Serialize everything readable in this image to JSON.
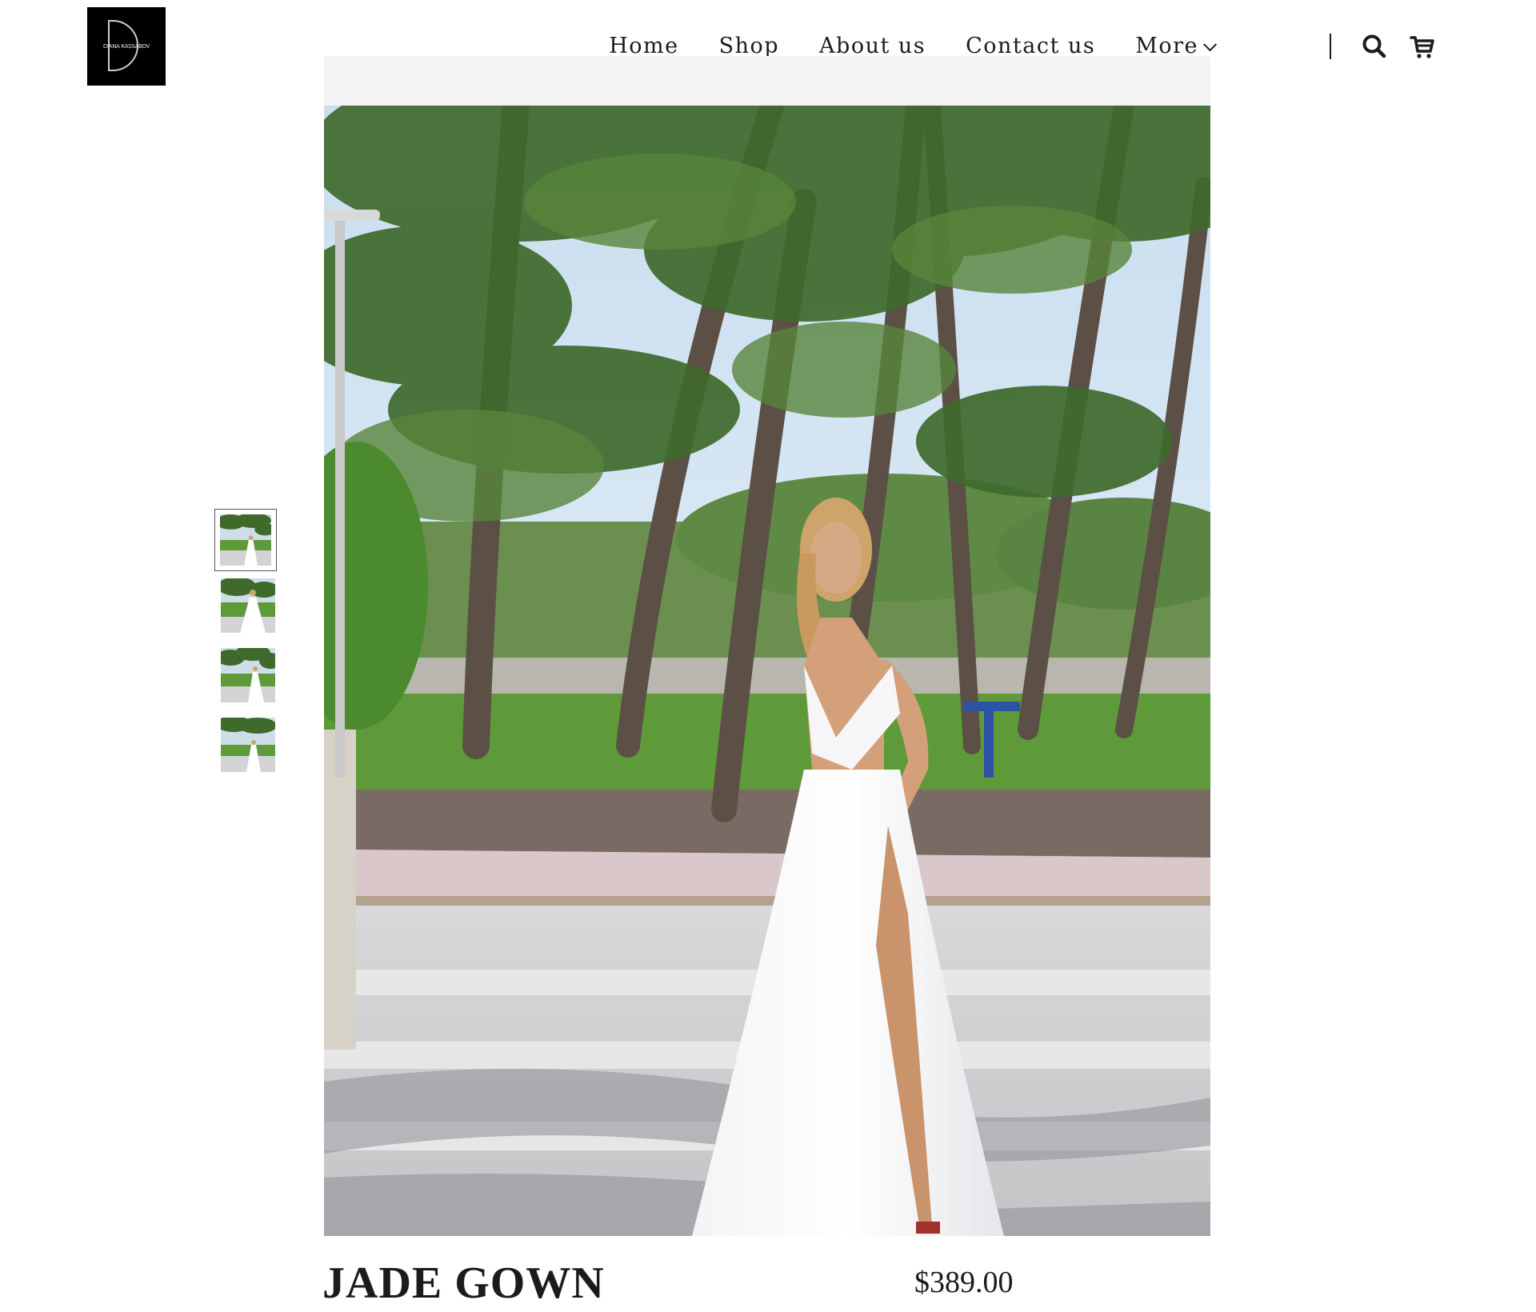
{
  "brand": {
    "logo_text": "DIANA KASSABOV",
    "logo_bg": "#000000"
  },
  "nav": {
    "items": [
      {
        "label": "Home",
        "active": false
      },
      {
        "label": "Shop",
        "active": true
      },
      {
        "label": "About us",
        "active": false
      },
      {
        "label": "Contact us",
        "active": false
      },
      {
        "label": "More",
        "active": false,
        "has_dropdown": true
      }
    ],
    "icons": [
      "search-icon",
      "cart-icon"
    ]
  },
  "gallery": {
    "main_image_alt": "Model in white gown among palm trees",
    "thumbnails": [
      {
        "selected": true
      },
      {
        "selected": false
      },
      {
        "selected": false
      },
      {
        "selected": false
      }
    ]
  },
  "product": {
    "title": "JADE GOWN",
    "price": "$389.00"
  }
}
